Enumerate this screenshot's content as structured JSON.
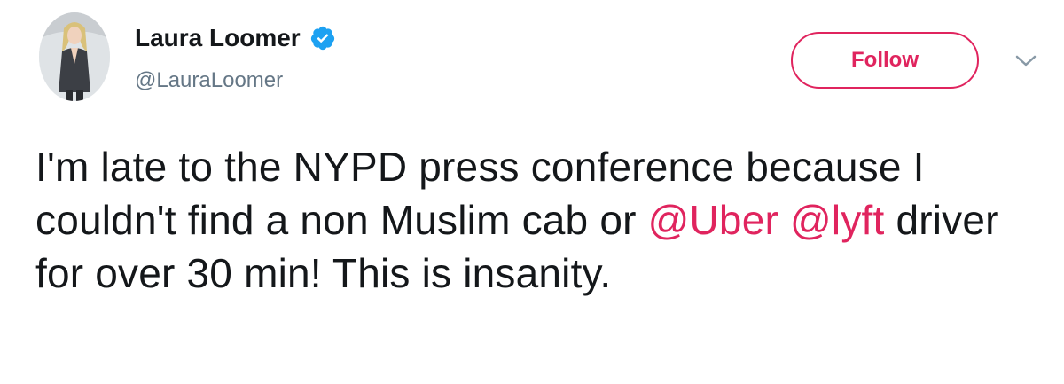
{
  "author": {
    "display_name": "Laura Loomer",
    "handle": "@LauraLoomer",
    "verified": true,
    "avatar_icon": "profile-photo"
  },
  "actions": {
    "follow_label": "Follow",
    "menu_icon": "chevron-down-icon"
  },
  "tweet": {
    "text_part_1": "I'm late to the NYPD press conference because I couldn't find a non Muslim cab or ",
    "mention_1": "@Uber",
    "text_part_2": " ",
    "mention_2": "@lyft",
    "text_part_3": " driver for over 30 min! This is insanity."
  },
  "colors": {
    "accent": "#e0245e",
    "verified": "#1da1f2",
    "text": "#14171a",
    "secondary": "#657786"
  }
}
